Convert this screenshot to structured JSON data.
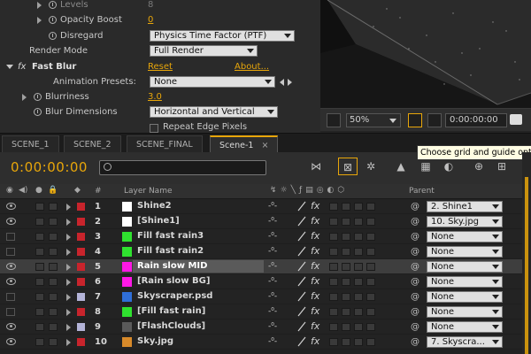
{
  "effect_controls": {
    "levels_label": "Levels",
    "levels_value": "8",
    "opacity_boost_label": "Opacity Boost",
    "opacity_boost_value": "0",
    "disregard_label": "Disregard",
    "disregard_value": "Physics Time Factor (PTF)",
    "render_mode_label": "Render Mode",
    "render_mode_value": "Full Render",
    "fx_badge": "fx",
    "effect_name": "Fast Blur",
    "reset_label": "Reset",
    "about_label": "About...",
    "presets_label": "Animation Presets:",
    "presets_value": "None",
    "blurriness_label": "Blurriness",
    "blurriness_value": "3.0",
    "blur_dimensions_label": "Blur Dimensions",
    "blur_dimensions_value": "Horizontal and Vertical",
    "repeat_edge_label": "Repeat Edge Pixels"
  },
  "viewer": {
    "zoom": "50%",
    "timecode": "0:00:00:00"
  },
  "tabs": [
    "SCENE_1",
    "SCENE_2",
    "SCENE_FINAL",
    "Scene-1"
  ],
  "timeline": {
    "timecode": "0:00:00:00",
    "search_placeholder": "",
    "tooltip": "Choose grid and guide options"
  },
  "columns": {
    "number": "#",
    "layer_name": "Layer Name",
    "parent": "Parent"
  },
  "layers": [
    {
      "num": "1",
      "name": "Shine2",
      "label_color": "#c8242c",
      "thumb_color": "#ffffff",
      "parent": "2. Shine1",
      "selected": false
    },
    {
      "num": "2",
      "name": "[Shine1]",
      "label_color": "#c8242c",
      "thumb_color": "#ffffff",
      "parent": "10. Sky.jpg",
      "selected": false
    },
    {
      "num": "3",
      "name": "Fill fast rain3",
      "label_color": "#c8242c",
      "thumb_color": "#2fe22f",
      "parent": "None",
      "selected": false
    },
    {
      "num": "4",
      "name": "Fill fast rain2",
      "label_color": "#c8242c",
      "thumb_color": "#2fe22f",
      "parent": "None",
      "selected": false
    },
    {
      "num": "5",
      "name": "Rain slow MID",
      "label_color": "#c8242c",
      "thumb_color": "#ff18e6",
      "parent": "None",
      "selected": true
    },
    {
      "num": "6",
      "name": "[Rain slow BG]",
      "label_color": "#c8242c",
      "thumb_color": "#ff18e6",
      "parent": "None",
      "selected": false
    },
    {
      "num": "7",
      "name": "Skyscraper.psd",
      "label_color": "#b4b4d8",
      "thumb_color": "#2f6fd8",
      "parent": "None",
      "selected": false
    },
    {
      "num": "8",
      "name": "[Fill fast rain]",
      "label_color": "#c8242c",
      "thumb_color": "#2fe22f",
      "parent": "None",
      "selected": false
    },
    {
      "num": "9",
      "name": "[FlashClouds]",
      "label_color": "#b4b4d8",
      "thumb_color": "#5a5a5a",
      "parent": "None",
      "selected": false
    },
    {
      "num": "10",
      "name": "Sky.jpg",
      "label_color": "#c8242c",
      "thumb_color": "#d88a2a",
      "parent": "7. Skyscra...",
      "selected": false
    }
  ],
  "colors": {
    "accent": "#e8a60a",
    "panel": "#2e2e2e"
  }
}
